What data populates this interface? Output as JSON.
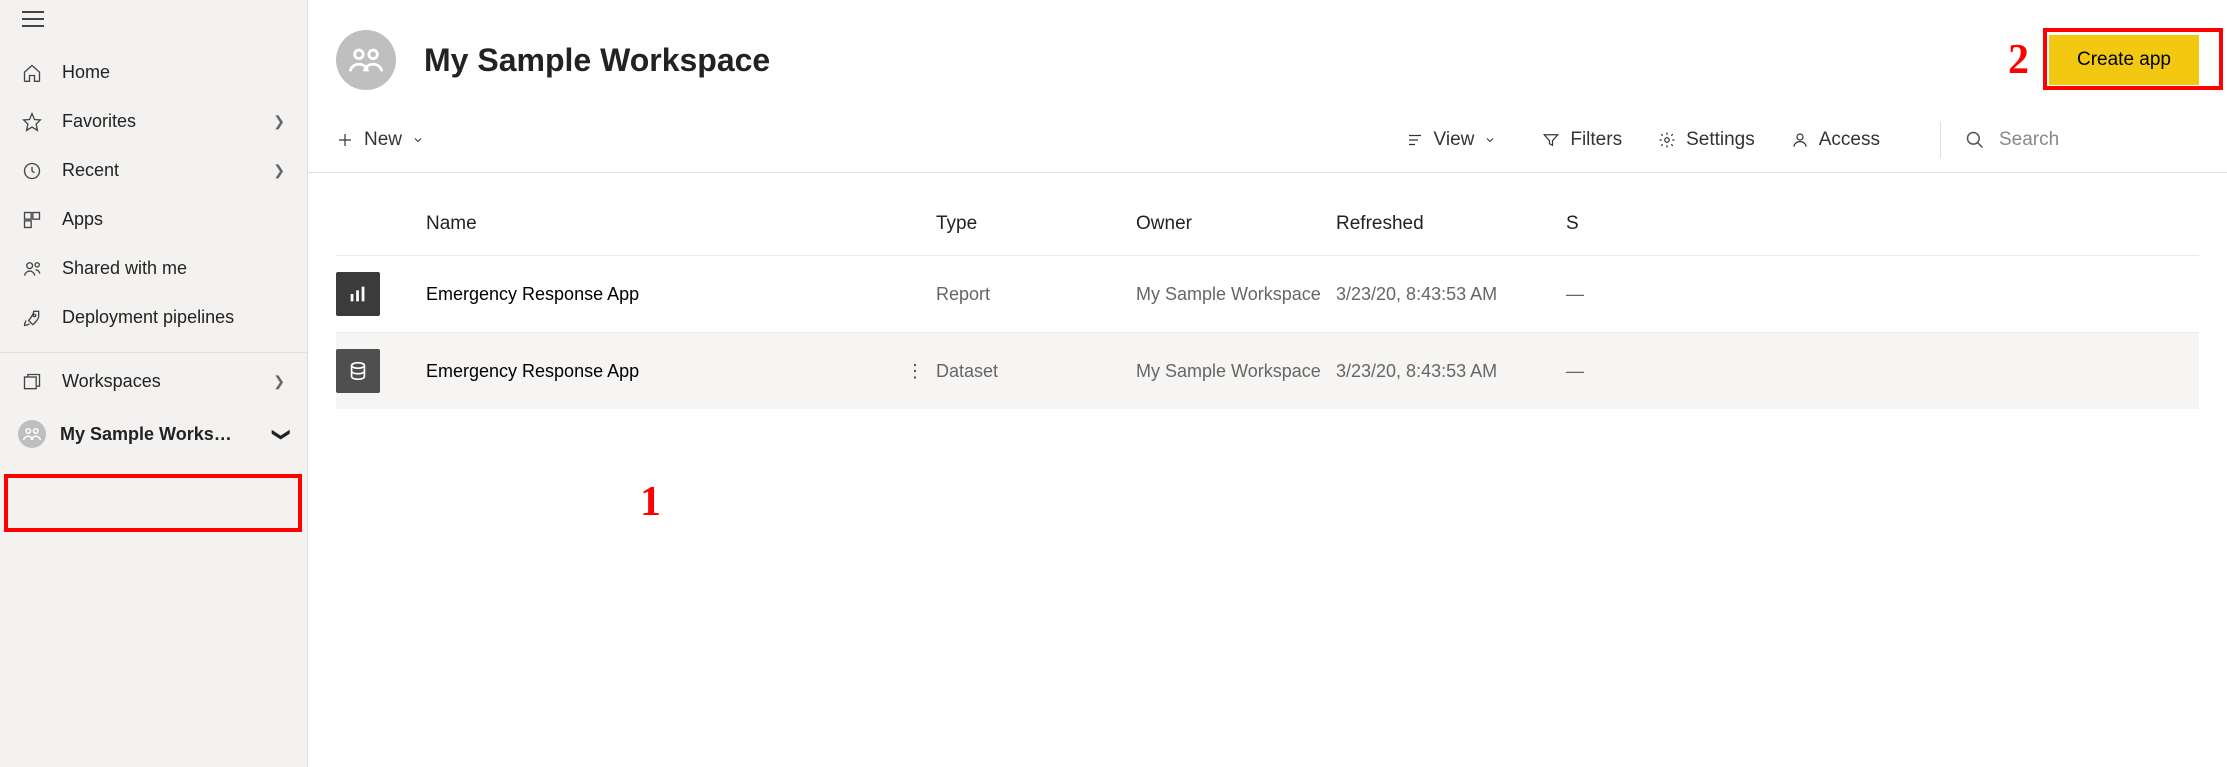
{
  "sidebar": {
    "items": [
      {
        "label": "Home",
        "chevron": false
      },
      {
        "label": "Favorites",
        "chevron": true
      },
      {
        "label": "Recent",
        "chevron": true
      },
      {
        "label": "Apps",
        "chevron": false
      },
      {
        "label": "Shared with me",
        "chevron": false
      },
      {
        "label": "Deployment pipelines",
        "chevron": false
      }
    ],
    "workspaces_label": "Workspaces",
    "current_workspace": "My Sample Works…"
  },
  "header": {
    "title": "My Sample Workspace",
    "create_app": "Create app"
  },
  "toolbar": {
    "new": "New",
    "view": "View",
    "filters": "Filters",
    "settings": "Settings",
    "access": "Access",
    "search_placeholder": "Search"
  },
  "table": {
    "columns": {
      "name": "Name",
      "type": "Type",
      "owner": "Owner",
      "refreshed": "Refreshed",
      "sensitivity": "S"
    },
    "rows": [
      {
        "name": "Emergency Response App",
        "type": "Report",
        "owner": "My Sample Workspace",
        "refreshed": "3/23/20, 8:43:53 AM",
        "sensitivity": "—",
        "icon": "report"
      },
      {
        "name": "Emergency Response App",
        "type": "Dataset",
        "owner": "My Sample Workspace",
        "refreshed": "3/23/20, 8:43:53 AM",
        "sensitivity": "—",
        "icon": "dataset"
      }
    ]
  },
  "annotations": {
    "one": "1",
    "two": "2"
  }
}
